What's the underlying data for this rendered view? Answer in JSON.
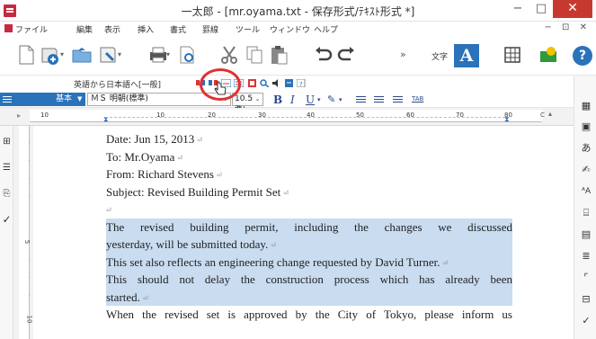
{
  "window": {
    "title": "一太郎 - [mr.oyama.txt - 保存形式/ﾃｷｽﾄ形式 *]",
    "minimize": "−",
    "maximize": "□",
    "close": "✕"
  },
  "menu": {
    "items": [
      "ファイル",
      "編集",
      "表示",
      "挿入",
      "書式",
      "罫線",
      "ツール",
      "ウィンドウ",
      "ヘルプ"
    ],
    "right_controls": "− ⊡ ✕"
  },
  "toolbar": {
    "more_chevron": "»",
    "style_label": "文字",
    "char_A": "A",
    "help": "?"
  },
  "translate_bar": {
    "label": "英語から日本語へ[一般]",
    "collapse": "◂"
  },
  "format_bar": {
    "style_name": "基本",
    "font_name": "ＭＳ 明朝(標準)",
    "font_size": "10.5(標準)",
    "bold": "B",
    "italic": "I",
    "underline": "U",
    "tab_label": "TAB"
  },
  "ruler": {
    "numbers": [
      "10",
      "10",
      "20",
      "30",
      "40",
      "50",
      "60",
      "70",
      "80"
    ],
    "right_mark": "C"
  },
  "vertical_ruler": {
    "numbers": [
      "5",
      "10"
    ]
  },
  "document": {
    "lines": [
      {
        "text": "Date: Jun 15, 2013",
        "selected": false,
        "justify": false,
        "mark": true
      },
      {
        "text": "To: Mr.Oyama",
        "selected": false,
        "justify": false,
        "mark": true
      },
      {
        "text": "From: Richard Stevens",
        "selected": false,
        "justify": false,
        "mark": true
      },
      {
        "text": "Subject: Revised Building Permit Set",
        "selected": false,
        "justify": false,
        "mark": true
      },
      {
        "text": "",
        "selected": false,
        "justify": false,
        "mark": true
      },
      {
        "text": "The revised building permit, including the changes we discussed",
        "selected": true,
        "justify": true,
        "mark": false
      },
      {
        "text": "yesterday, will be submitted today.",
        "selected": true,
        "justify": false,
        "mark": true
      },
      {
        "text": "This set also reflects an engineering change requested by David Turner.",
        "selected": true,
        "justify": false,
        "mark": true
      },
      {
        "text": "This should not delay the construction process which has already been",
        "selected": true,
        "justify": true,
        "mark": false
      },
      {
        "text": "started.",
        "selected": true,
        "justify": false,
        "mark": true
      },
      {
        "text": "When the revised set is approved by the City of Tokyo, please inform us",
        "selected": false,
        "justify": true,
        "mark": false
      }
    ],
    "paragraph_mark": "⏎"
  },
  "icons": {
    "left": [
      "grid-icon",
      "list-icon",
      "outline-icon",
      "check-icon"
    ],
    "right": [
      "layout-icon",
      "calendar-icon",
      "kana-icon",
      "pen-icon",
      "font-size-icon",
      "ruby-icon",
      "document-icon",
      "indent-icon",
      "frame-icon",
      "table-icon",
      "check-icon"
    ]
  },
  "colors": {
    "accent": "#2a72b9",
    "selection": "#c9dcf0",
    "highlight_circle": "#e03131",
    "app_red": "#c7293f"
  }
}
